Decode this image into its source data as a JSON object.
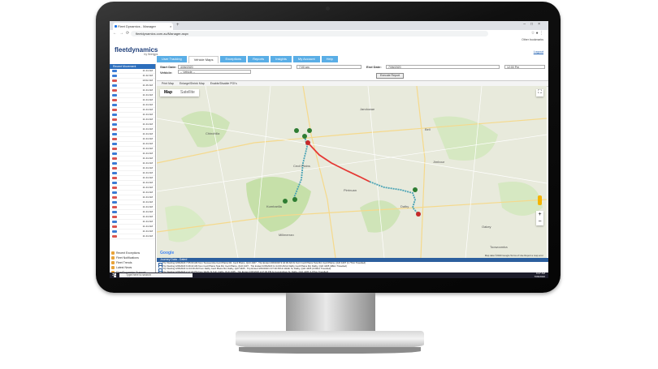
{
  "browser": {
    "tab_title": "Fleet Dynamics - Manager",
    "url": "fleetdynamics.com.au/Manager.aspx",
    "bookmarks_label": "Other bookmarks"
  },
  "app": {
    "logo": "fleetdynamics",
    "logo_sub": "by fleetgps",
    "logout": "Logout",
    "menu": [
      "User Tracking",
      "Vehicle Maps",
      "Exceptions",
      "Reports",
      "Insights",
      "My Account",
      "Help"
    ],
    "active_menu": "Vehicle Maps"
  },
  "left_panel": {
    "header": "Recent Movement",
    "rows": [
      {
        "name": "",
        "time": "11:44 AM",
        "color": "#3a7bd5"
      },
      {
        "name": "",
        "time": "11:42 AM",
        "color": "#3a7bd5"
      },
      {
        "name": "",
        "time": "10:02 AM",
        "color": "#d9534f"
      },
      {
        "name": "",
        "time": "11:46 AM",
        "color": "#3a7bd5"
      },
      {
        "name": "",
        "time": "11:44 AM",
        "color": "#d9534f"
      },
      {
        "name": "",
        "time": "11:44 AM",
        "color": "#3a7bd5"
      },
      {
        "name": "",
        "time": "11:44 AM",
        "color": "#d9534f"
      },
      {
        "name": "",
        "time": "11:44 AM",
        "color": "#3a7bd5"
      },
      {
        "name": "",
        "time": "11:44 AM",
        "color": "#d9534f"
      },
      {
        "name": "",
        "time": "11:44 AM",
        "color": "#3a7bd5"
      },
      {
        "name": "",
        "time": "11:44 AM",
        "color": "#d9534f"
      },
      {
        "name": "",
        "time": "11:44 AM",
        "color": "#3a7bd5"
      },
      {
        "name": "",
        "time": "11:44 AM",
        "color": "#d9534f"
      },
      {
        "name": "",
        "time": "11:44 AM",
        "color": "#3a7bd5"
      },
      {
        "name": "",
        "time": "11:44 AM",
        "color": "#d9534f"
      },
      {
        "name": "",
        "time": "11:44 AM",
        "color": "#3a7bd5"
      },
      {
        "name": "",
        "time": "11:44 AM",
        "color": "#d9534f"
      },
      {
        "name": "",
        "time": "11:44 AM",
        "color": "#3a7bd5"
      },
      {
        "name": "",
        "time": "11:44 AM",
        "color": "#d9534f"
      },
      {
        "name": "",
        "time": "11:44 AM",
        "color": "#3a7bd5"
      },
      {
        "name": "",
        "time": "11:44 AM",
        "color": "#d9534f"
      },
      {
        "name": "",
        "time": "11:44 AM",
        "color": "#3a7bd5"
      },
      {
        "name": "",
        "time": "11:44 AM",
        "color": "#d9534f"
      },
      {
        "name": "",
        "time": "11:44 AM",
        "color": "#3a7bd5"
      },
      {
        "name": "",
        "time": "11:44 AM",
        "color": "#d9534f"
      },
      {
        "name": "",
        "time": "11:44 AM",
        "color": "#3a7bd5"
      },
      {
        "name": "",
        "time": "11:44 AM",
        "color": "#d9534f"
      },
      {
        "name": "",
        "time": "11:44 AM",
        "color": "#3a7bd5"
      },
      {
        "name": "",
        "time": "11:44 AM",
        "color": "#d9534f"
      },
      {
        "name": "",
        "time": "11:44 AM",
        "color": "#3a7bd5"
      },
      {
        "name": "",
        "time": "11:44 AM",
        "color": "#d9534f"
      },
      {
        "name": "",
        "time": "11:44 AM",
        "color": "#3a7bd5"
      },
      {
        "name": "",
        "time": "11:44 AM",
        "color": "#d9534f"
      },
      {
        "name": "",
        "time": "11:44 AM",
        "color": "#3a7bd5"
      },
      {
        "name": "",
        "time": "11:44 AM",
        "color": "#d9534f"
      }
    ],
    "bottom_menu": [
      "Recent Exceptions",
      "Fleet Notifications",
      "Fleet Trends",
      "Latest News",
      "FleetDynamics Support"
    ]
  },
  "form": {
    "start_label": "Start Date:",
    "start_date": "4/06/2020",
    "start_time": "7:00 am",
    "end_label": "End Date:",
    "end_date": "7/06/2020",
    "end_time": "12:00 Pm",
    "vehicle_label": "Vehicle:",
    "vehicle_value": "-- Vehicle --",
    "run_button": "Execute Report"
  },
  "tools": [
    "Print Map",
    "Enlarge/Shrink Map",
    "Enable/Disable POI's"
  ],
  "map": {
    "type_map": "Map",
    "type_satellite": "Satellite",
    "google": "Google",
    "footer": "Map data ©2020 Google  Terms of Use  Report a map error",
    "places": [
      "Toowoomba",
      "Cecil Plains",
      "Dalby",
      "Kumbarilla",
      "Pirrinuan",
      "Jimbour",
      "Bell",
      "Jandowae",
      "Chinchilla",
      "Oakey",
      "Millmerran"
    ]
  },
  "journey": {
    "header": "Journey Data - Dated",
    "rows": [
      "Trip Starting 4/06/2020 7:05:00 AM from Toowoomba Cecil Plains Rd, Cecil Plains, QLD 4407 - Trip Ended 4/06/2020 9:42:00 AM At Kurri Cecil Plains Tara Rd, Cecil Plains, QLD 4407 (1.77km Travelled)",
      "Trip Starting 4/06/2020 9:49:22 AM from Cecil Plains Tara Rd, Cecil Plains, QLD 4407 - Trip Ended 4/06/2020 11:14:00 AM At Dalby Cecil Plains Rd, Dalby, QLD 4405 (48km Travelled)",
      "Trip Starting 4/06/2020 11:34:00 AM from Dalby Cecil Plains Rd, Dalby, QLD 4405 - Trip Ended 4/06/2020 2:07:00 PM At Webb St, Dalby, QLD 4405 (0.60km Travelled)",
      "Trip Starting 4/06/2020 2:17:00 PM from Webb St Kuh, Dalby, QLD 4405 - Trip Ended 4/06/2020 2:27:00 PM At Cunningham St, Dalby, QLD 4405 (1.87km Travelled)"
    ]
  },
  "taskbar": {
    "search": "Type here to search",
    "time": "9:47 AM",
    "date": "7/06/2020"
  },
  "colors": {
    "menu_blue": "#5aaee6",
    "header_blue": "#2c6ebc",
    "route_red": "#e53935",
    "route_teal": "#4aa3b5"
  }
}
